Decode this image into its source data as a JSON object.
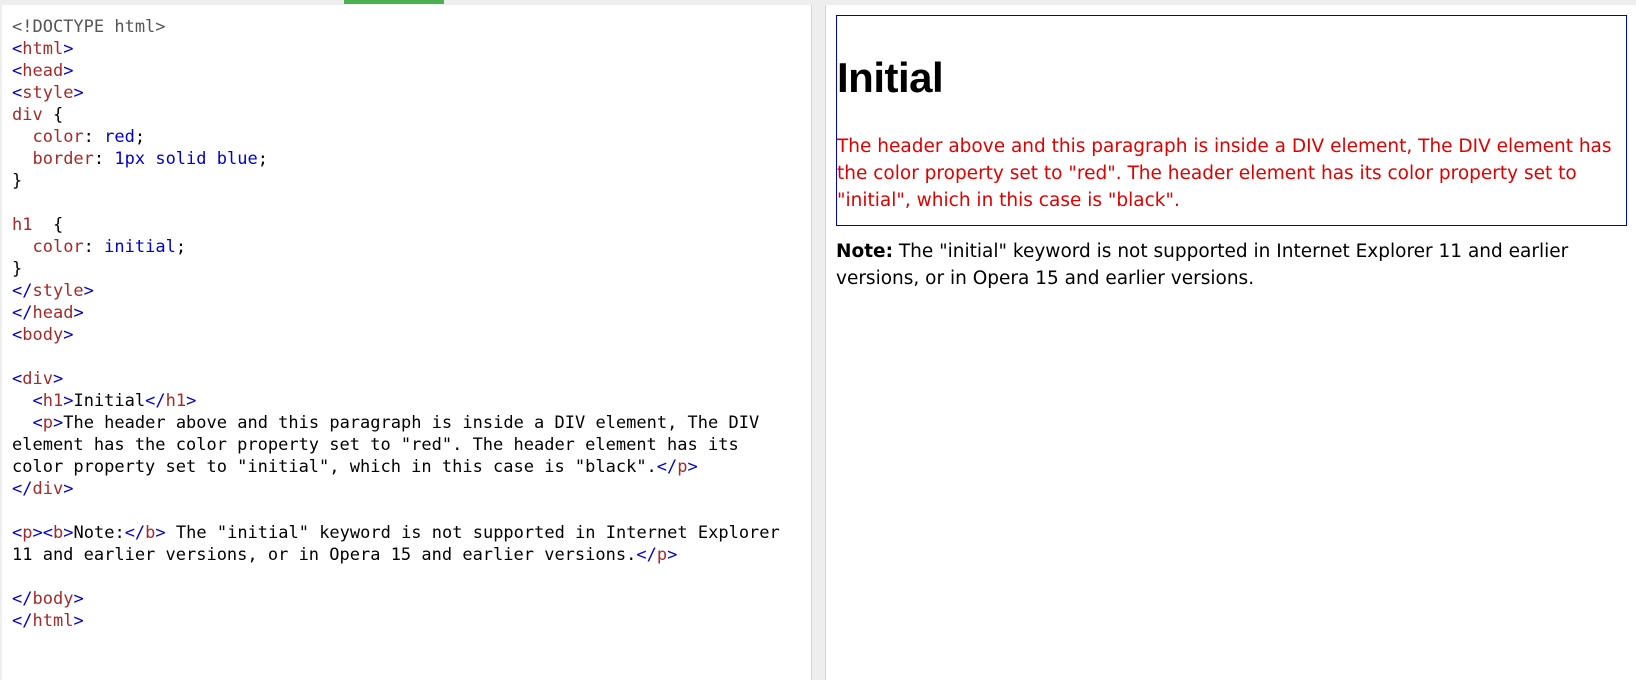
{
  "editor": {
    "lines": [
      [
        {
          "c": "doctype",
          "t": "<!DOCTYPE html>"
        }
      ],
      [
        {
          "c": "br",
          "t": "<"
        },
        {
          "c": "tag",
          "t": "html"
        },
        {
          "c": "br",
          "t": ">"
        }
      ],
      [
        {
          "c": "br",
          "t": "<"
        },
        {
          "c": "tag",
          "t": "head"
        },
        {
          "c": "br",
          "t": ">"
        }
      ],
      [
        {
          "c": "br",
          "t": "<"
        },
        {
          "c": "tag",
          "t": "style"
        },
        {
          "c": "br",
          "t": ">"
        }
      ],
      [
        {
          "c": "kw",
          "t": "div"
        },
        {
          "c": "punc",
          "t": " {"
        }
      ],
      [
        {
          "c": "punc",
          "t": "  "
        },
        {
          "c": "kw",
          "t": "color"
        },
        {
          "c": "punc",
          "t": ":"
        },
        {
          "c": "val",
          "t": " red"
        },
        {
          "c": "punc",
          "t": ";"
        }
      ],
      [
        {
          "c": "punc",
          "t": "  "
        },
        {
          "c": "kw",
          "t": "border"
        },
        {
          "c": "punc",
          "t": ":"
        },
        {
          "c": "val",
          "t": " 1px solid blue"
        },
        {
          "c": "punc",
          "t": ";"
        }
      ],
      [
        {
          "c": "punc",
          "t": "}"
        }
      ],
      [
        {
          "c": "punc",
          "t": ""
        }
      ],
      [
        {
          "c": "kw",
          "t": "h1"
        },
        {
          "c": "punc",
          "t": "  {"
        }
      ],
      [
        {
          "c": "punc",
          "t": "  "
        },
        {
          "c": "kw",
          "t": "color"
        },
        {
          "c": "punc",
          "t": ":"
        },
        {
          "c": "val",
          "t": " initial"
        },
        {
          "c": "punc",
          "t": ";"
        }
      ],
      [
        {
          "c": "punc",
          "t": "}"
        }
      ],
      [
        {
          "c": "br",
          "t": "</"
        },
        {
          "c": "tag",
          "t": "style"
        },
        {
          "c": "br",
          "t": ">"
        }
      ],
      [
        {
          "c": "br",
          "t": "</"
        },
        {
          "c": "tag",
          "t": "head"
        },
        {
          "c": "br",
          "t": ">"
        }
      ],
      [
        {
          "c": "br",
          "t": "<"
        },
        {
          "c": "tag",
          "t": "body"
        },
        {
          "c": "br",
          "t": ">"
        }
      ],
      [
        {
          "c": "punc",
          "t": ""
        }
      ],
      [
        {
          "c": "br",
          "t": "<"
        },
        {
          "c": "tag",
          "t": "div"
        },
        {
          "c": "br",
          "t": ">"
        }
      ],
      [
        {
          "c": "punc",
          "t": "  "
        },
        {
          "c": "br",
          "t": "<"
        },
        {
          "c": "tag",
          "t": "h1"
        },
        {
          "c": "br",
          "t": ">"
        },
        {
          "c": "txt",
          "t": "Initial"
        },
        {
          "c": "br",
          "t": "</"
        },
        {
          "c": "tag",
          "t": "h1"
        },
        {
          "c": "br",
          "t": ">"
        }
      ],
      [
        {
          "c": "punc",
          "t": "  "
        },
        {
          "c": "br",
          "t": "<"
        },
        {
          "c": "tag",
          "t": "p"
        },
        {
          "c": "br",
          "t": ">"
        },
        {
          "c": "txt",
          "t": "The header above and this paragraph is inside a DIV element, The DIV"
        }
      ],
      [
        {
          "c": "txt",
          "t": "element has the color property set to \"red\". The header element has its"
        }
      ],
      [
        {
          "c": "txt",
          "t": "color property set to \"initial\", which in this case is \"black\"."
        },
        {
          "c": "br",
          "t": "</"
        },
        {
          "c": "tag",
          "t": "p"
        },
        {
          "c": "br",
          "t": ">"
        }
      ],
      [
        {
          "c": "br",
          "t": "</"
        },
        {
          "c": "tag",
          "t": "div"
        },
        {
          "c": "br",
          "t": ">"
        }
      ],
      [
        {
          "c": "punc",
          "t": ""
        }
      ],
      [
        {
          "c": "br",
          "t": "<"
        },
        {
          "c": "tag",
          "t": "p"
        },
        {
          "c": "br",
          "t": ">"
        },
        {
          "c": "br",
          "t": "<"
        },
        {
          "c": "tag",
          "t": "b"
        },
        {
          "c": "br",
          "t": ">"
        },
        {
          "c": "txt",
          "t": "Note:"
        },
        {
          "c": "br",
          "t": "</"
        },
        {
          "c": "tag",
          "t": "b"
        },
        {
          "c": "br",
          "t": ">"
        },
        {
          "c": "txt",
          "t": " The \"initial\" keyword is not supported in Internet Explorer"
        }
      ],
      [
        {
          "c": "txt",
          "t": "11 and earlier versions, or in Opera 15 and earlier versions."
        },
        {
          "c": "br",
          "t": "</"
        },
        {
          "c": "tag",
          "t": "p"
        },
        {
          "c": "br",
          "t": ">"
        }
      ],
      [
        {
          "c": "punc",
          "t": ""
        }
      ],
      [
        {
          "c": "br",
          "t": "</"
        },
        {
          "c": "tag",
          "t": "body"
        },
        {
          "c": "br",
          "t": ">"
        }
      ],
      [
        {
          "c": "br",
          "t": "</"
        },
        {
          "c": "tag",
          "t": "html"
        },
        {
          "c": "br",
          "t": ">"
        }
      ]
    ]
  },
  "preview": {
    "heading": "Initial",
    "paragraph": "The header above and this paragraph is inside a DIV element, The DIV element has the color property set to \"red\". The header element has its color property set to \"initial\", which in this case is \"black\".",
    "note_label": "Note:",
    "note_text": " The \"initial\" keyword is not supported in Internet Explorer 11 and earlier versions, or in Opera 15 and earlier versions."
  },
  "colors": {
    "accent": "#4caf50",
    "tag": "#a52a2a",
    "value": "#0000cd",
    "demo_text": "#e00000",
    "border": "#0000cd"
  }
}
